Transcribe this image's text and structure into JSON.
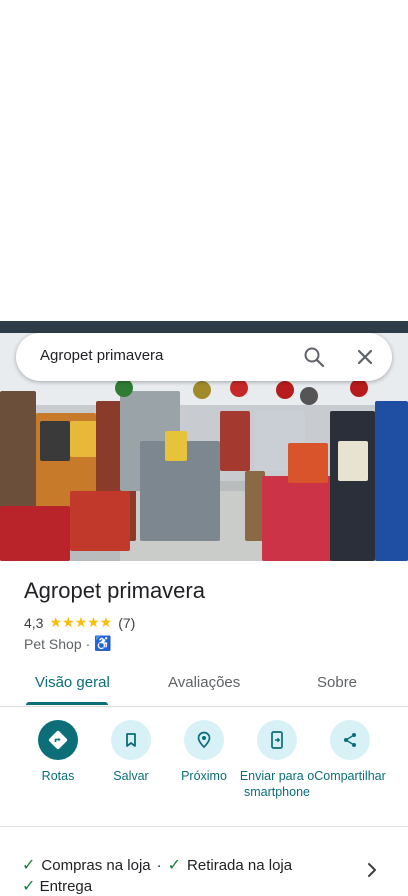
{
  "search": {
    "query": "Agropet primavera"
  },
  "place": {
    "name": "Agropet primavera",
    "rating": "4,3",
    "stars": "★★★★★",
    "review_count": "(7)",
    "category": "Pet Shop",
    "separator": "·"
  },
  "tabs": [
    {
      "label": "Visão geral",
      "active": true
    },
    {
      "label": "Avaliações",
      "active": false
    },
    {
      "label": "Sobre",
      "active": false
    }
  ],
  "actions": [
    {
      "label": "Rotas",
      "icon": "directions-icon"
    },
    {
      "label": "Salvar",
      "icon": "bookmark-icon"
    },
    {
      "label": "Próximo",
      "icon": "nearby-icon"
    },
    {
      "label": "Enviar para o smartphone",
      "icon": "send-to-phone-icon"
    },
    {
      "label": "Compartilhar",
      "icon": "share-icon"
    }
  ],
  "services": {
    "item1": "Compras na loja",
    "dot": "·",
    "item2": "Retirada na loja",
    "item3": "Entrega"
  },
  "colors": {
    "accent": "#0b6e79",
    "accent_light": "#d7f1f7",
    "star": "#fbbc04",
    "check": "#188038"
  }
}
